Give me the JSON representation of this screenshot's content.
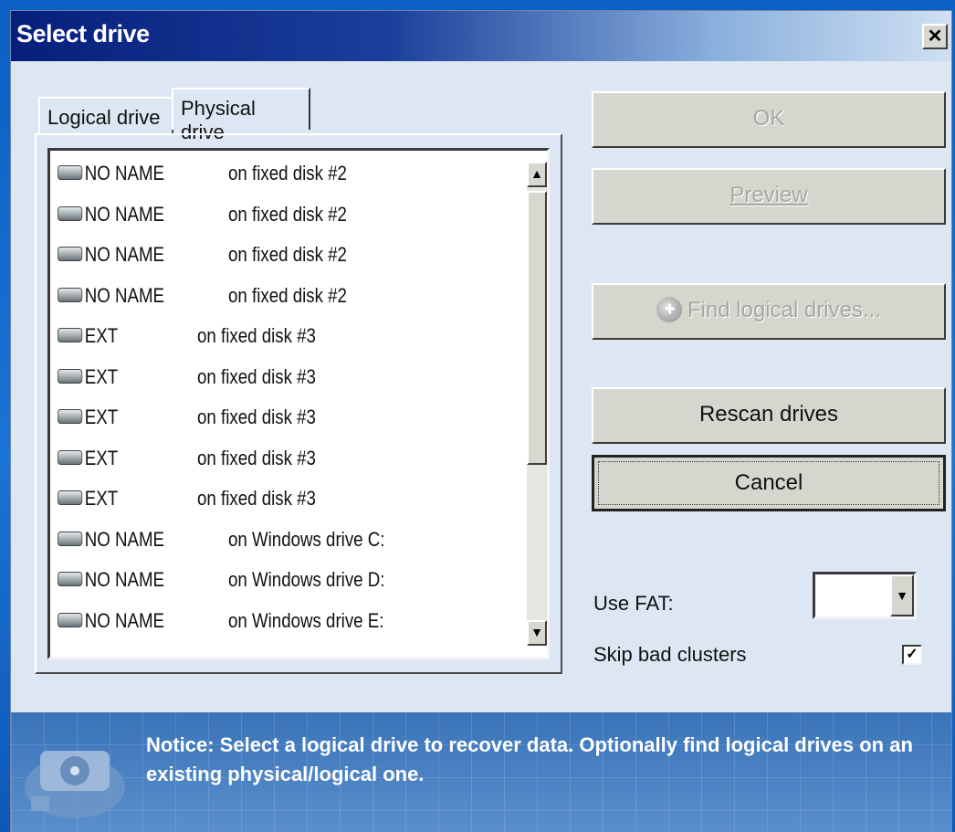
{
  "window": {
    "title": "Select drive",
    "close_label": "✕"
  },
  "tabs": [
    {
      "label": "Logical drive",
      "selected": true
    },
    {
      "label": "Physical drive",
      "selected": false
    }
  ],
  "drives": [
    {
      "name": "NO NAME",
      "location": "on fixed disk #2"
    },
    {
      "name": "NO NAME",
      "location": "on fixed disk #2"
    },
    {
      "name": "NO NAME",
      "location": "on fixed disk #2"
    },
    {
      "name": "NO NAME",
      "location": "on fixed disk #2"
    },
    {
      "name": "EXT",
      "location": "on fixed disk #3"
    },
    {
      "name": "EXT",
      "location": "on fixed disk #3"
    },
    {
      "name": "EXT",
      "location": "on fixed disk #3"
    },
    {
      "name": "EXT",
      "location": "on fixed disk #3"
    },
    {
      "name": "EXT",
      "location": "on fixed disk #3"
    },
    {
      "name": "NO NAME",
      "location": "on Windows drive C:"
    },
    {
      "name": "NO NAME",
      "location": "on Windows drive D:"
    },
    {
      "name": "NO NAME",
      "location": "on Windows drive E:"
    }
  ],
  "buttons": {
    "ok": "OK",
    "preview": "Preview",
    "find": "Find logical drives...",
    "rescan": "Rescan drives",
    "cancel": "Cancel"
  },
  "options": {
    "use_fat_label": "Use FAT:",
    "use_fat_value": "",
    "skip_label": "Skip bad clusters",
    "skip_checked": true,
    "skip_mark": "✓"
  },
  "notice": "Notice: Select a logical drive to recover data. Optionally find logical drives on an existing physical/logical one.",
  "scrollbar": {
    "up": "▲",
    "down": "▼"
  },
  "colors": {
    "title_start": "#071e7c",
    "window_bg": "#dde7f3",
    "notice_bg": "#3a73b9"
  }
}
